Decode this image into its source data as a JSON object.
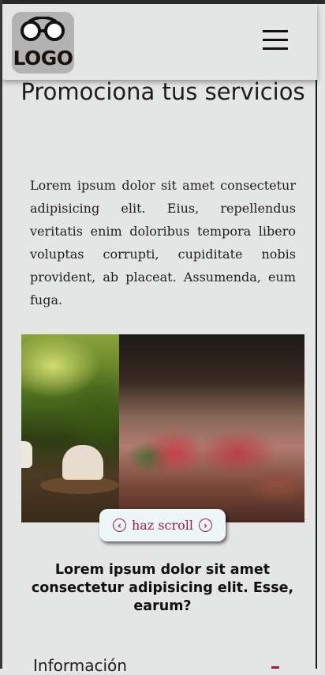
{
  "header": {
    "logo_text": "LOGO",
    "menu_icon": "hamburger-menu-icon"
  },
  "main": {
    "title": "Promociona tus servicios",
    "paragraph": "Lorem ipsum dolor sit amet consectetur adipisicing elit. Eius, repellendus veritatis enim doloribus tempora libero voluptas corrupti, cupiditate nobis provident, ab placeat. Assumenda, eum fuga.",
    "gallery": [
      "cupcakes-photo",
      "pizza-photo"
    ],
    "scroll_hint": {
      "label": "haz scroll",
      "left_icon": "chevron-left-circle-icon",
      "right_icon": "chevron-right-circle-icon"
    },
    "subtitle": "Lorem ipsum dolor sit amet consectetur adipisicing elit. Esse, earum?",
    "section_label": "Información"
  },
  "colors": {
    "background": "#e4e5e5",
    "accent": "#9c1c4f",
    "logo_bg": "#b3b3b3"
  }
}
